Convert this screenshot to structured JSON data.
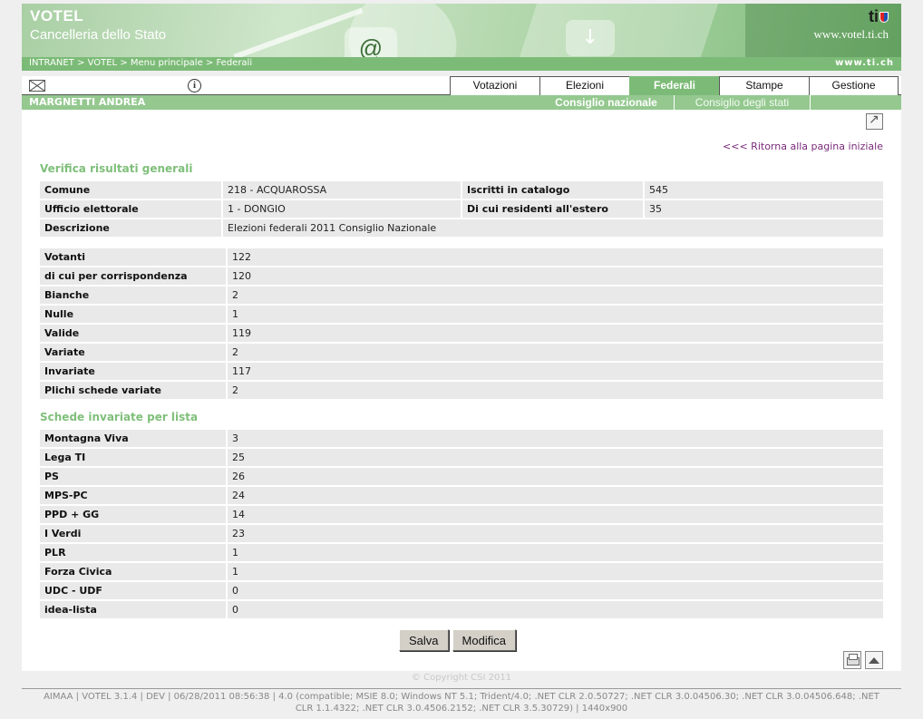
{
  "header": {
    "app_name": "VOTEL",
    "org_name": "Cancelleria dello Stato",
    "site_url": "www.votel.ti.ch",
    "logo_text": "ti",
    "breadcrumb": "INTRANET > VOTEL > Menu principale > Federali",
    "ti_ch": "www.ti.ch",
    "banner_at": "@",
    "banner_arrow": "↓"
  },
  "nav": {
    "info_glyph": "i",
    "tabs": [
      {
        "label": "Votazioni",
        "active": false
      },
      {
        "label": "Elezioni",
        "active": false
      },
      {
        "label": "Federali",
        "active": true
      },
      {
        "label": "Stampe",
        "active": false
      },
      {
        "label": "Gestione",
        "active": false
      }
    ]
  },
  "user": {
    "name": "MARGNETTI ANDREA",
    "subtabs": [
      {
        "label": "Consiglio nazionale",
        "active": true
      },
      {
        "label": "Consiglio degli stati",
        "active": false
      }
    ]
  },
  "back_link": "<<< Ritorna alla pagina iniziale",
  "general": {
    "title": "Verifica risultati generali",
    "comune_label": "Comune",
    "comune_value": "218 - ACQUAROSSA",
    "iscritti_label": "Iscritti in catalogo",
    "iscritti_value": "545",
    "ufficio_label": "Ufficio elettorale",
    "ufficio_value": "1 - DONGIO",
    "residenti_label": "Di cui residenti all'estero",
    "residenti_value": "35",
    "descrizione_label": "Descrizione",
    "descrizione_value": "Elezioni federali 2011 Consiglio Nazionale"
  },
  "votes": [
    {
      "label": "Votanti",
      "value": "122"
    },
    {
      "label": "di cui per corrispondenza",
      "value": "120"
    },
    {
      "label": "Bianche",
      "value": "2"
    },
    {
      "label": "Nulle",
      "value": "1"
    },
    {
      "label": "Valide",
      "value": "119"
    },
    {
      "label": "Variate",
      "value": "2"
    },
    {
      "label": "Invariate",
      "value": "117"
    },
    {
      "label": "Plichi schede variate",
      "value": "2"
    }
  ],
  "lists": {
    "title": "Schede invariate per lista",
    "rows": [
      {
        "label": "Montagna Viva",
        "value": "3"
      },
      {
        "label": "Lega TI",
        "value": "25"
      },
      {
        "label": "PS",
        "value": "26"
      },
      {
        "label": "MPS-PC",
        "value": "24"
      },
      {
        "label": "PPD + GG",
        "value": "14"
      },
      {
        "label": "I Verdi",
        "value": "23"
      },
      {
        "label": "PLR",
        "value": "1"
      },
      {
        "label": "Forza Civica",
        "value": "1"
      },
      {
        "label": "UDC - UDF",
        "value": "0"
      },
      {
        "label": "idea-lista",
        "value": "0"
      }
    ]
  },
  "buttons": {
    "save": "Salva",
    "edit": "Modifica"
  },
  "copyright": "© Copyright CSI 2011",
  "footer": "AIMAA | VOTEL 3.1.4 | DEV | 06/28/2011 08:56:38 | 4.0 (compatible; MSIE 8.0; Windows NT 5.1; Trident/4.0; .NET CLR 2.0.50727; .NET CLR 3.0.04506.30; .NET CLR 3.0.04506.648; .NET CLR 1.1.4322; .NET CLR 3.0.4506.2152; .NET CLR 3.5.30729) | 1440x900"
}
